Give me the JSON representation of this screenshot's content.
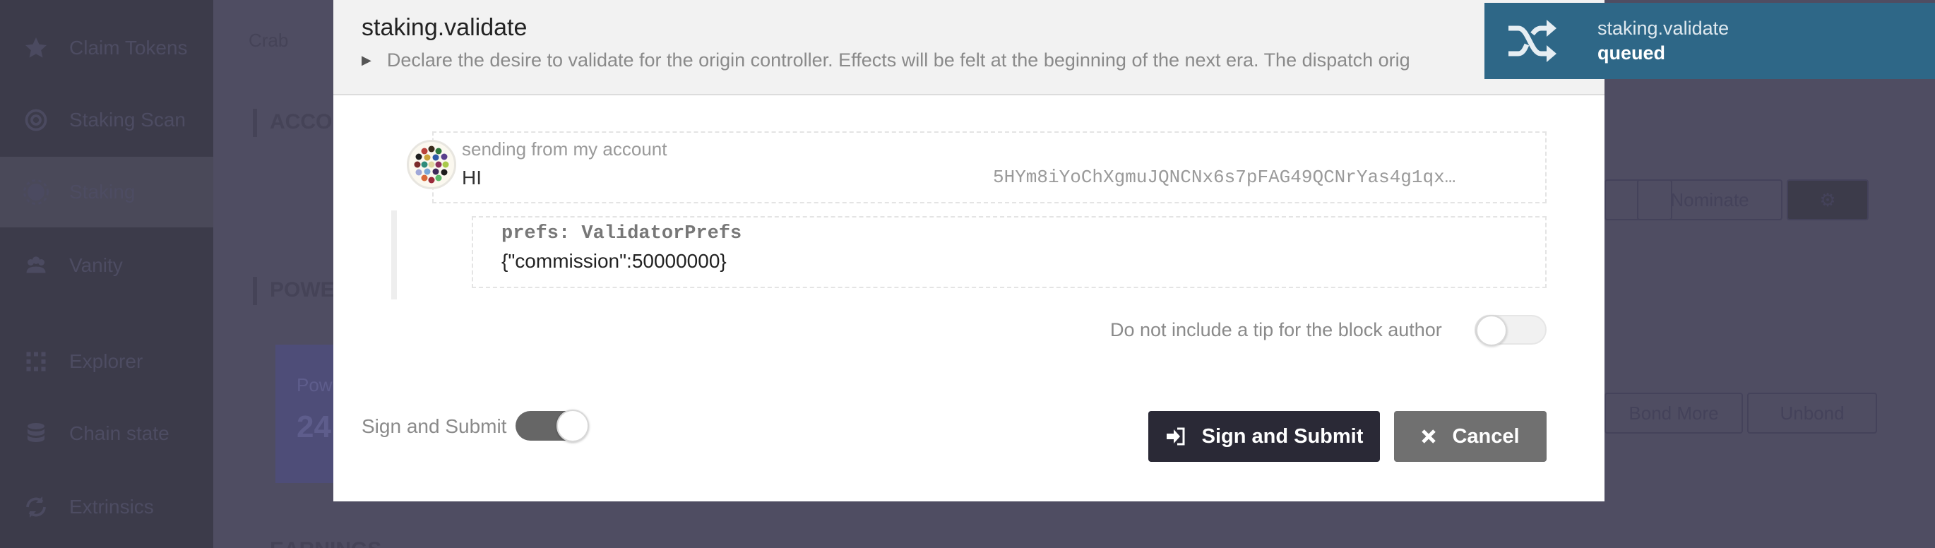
{
  "sidebar": {
    "items": [
      {
        "label": "Claim Tokens",
        "icon": "star-icon"
      },
      {
        "label": "Staking Scan",
        "icon": "scan-icon"
      },
      {
        "label": "Staking",
        "icon": "staking-icon"
      },
      {
        "label": "Vanity",
        "icon": "users-icon"
      },
      {
        "label": "Explorer",
        "icon": "explorer-icon"
      },
      {
        "label": "Chain state",
        "icon": "database-icon"
      },
      {
        "label": "Extrinsics",
        "icon": "sync-icon"
      }
    ]
  },
  "background": {
    "breadcrumb": "Crab",
    "section_account": "ACCO",
    "section_power": "POWE",
    "section_earnings": "EARNINGS",
    "nominate_button": "Nominate",
    "bond_more_button": "Bond More",
    "unbond_button": "Unbond",
    "power_card_label": "Pow",
    "power_card_value": "24"
  },
  "modal": {
    "title": "staking.validate",
    "description": "Declare the desire to validate for the origin controller. Effects will be felt at the beginning of the next era. The dispatch orig",
    "account": {
      "label": "sending from my account",
      "name": "HI",
      "address": "5HYm8iYoChXgmuJQNCNx6s7pFAG49QCNrYas4g1qx…"
    },
    "param": {
      "label": "prefs: ValidatorPrefs",
      "value": "{\"commission\":50000000}"
    },
    "tip_toggle": {
      "label": "Do not include a tip for the block author",
      "on": false
    },
    "sign_toggle": {
      "label": "Sign and Submit",
      "on": true
    },
    "buttons": {
      "sign_submit": "Sign and Submit",
      "cancel": "Cancel"
    }
  },
  "notification": {
    "title": "staking.validate",
    "status": "queued",
    "icon": "shuffle-icon",
    "color": "#2e6787"
  }
}
